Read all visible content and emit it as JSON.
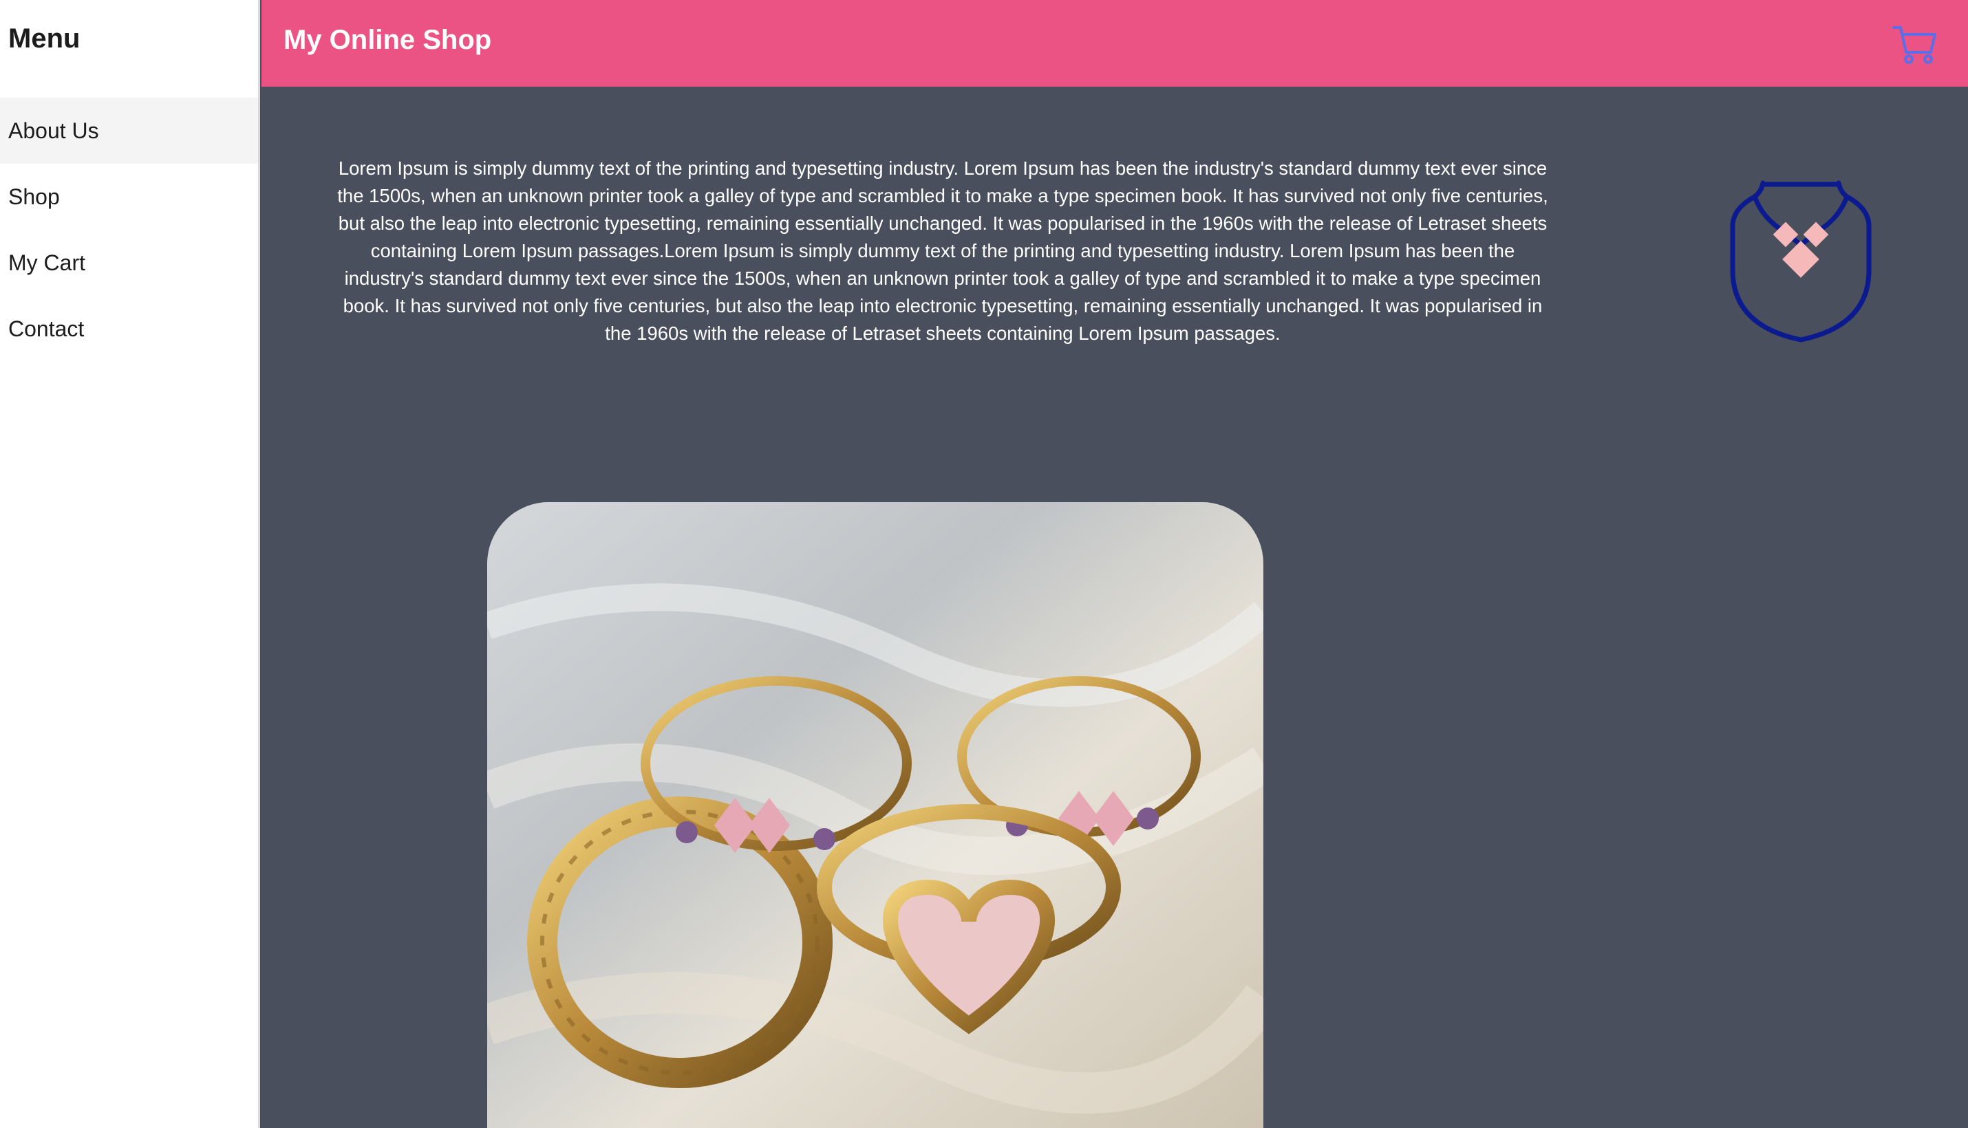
{
  "sidebar": {
    "title": "Menu",
    "items": [
      {
        "label": "About Us",
        "active": true
      },
      {
        "label": "Shop",
        "active": false
      },
      {
        "label": "My Cart",
        "active": false
      },
      {
        "label": "Contact",
        "active": false
      }
    ]
  },
  "header": {
    "title": "My Online Shop",
    "cart_icon": "cart-icon",
    "background_color": "#ea5384"
  },
  "main": {
    "background_color": "#4a4f5d",
    "intro_text": "Lorem Ipsum is simply dummy text of the printing and typesetting industry. Lorem Ipsum has been the industry's standard dummy text ever since the 1500s, when an unknown printer took a galley of type and scrambled it to make a type specimen book. It has survived not only five centuries, but also the leap into electronic typesetting, remaining essentially unchanged. It was popularised in the 1960s with the release of Letraset sheets containing Lorem Ipsum passages.Lorem Ipsum is simply dummy text of the printing and typesetting industry. Lorem Ipsum has been the industry's standard dummy text ever since the 1500s, when an unknown printer took a galley of type and scrambled it to make a type specimen book. It has survived not only five centuries, but also the leap into electronic typesetting, remaining essentially unchanged. It was popularised in the 1960s with the release of Letraset sheets containing Lorem Ipsum passages.",
    "logo_icon": "necklace-logo-icon",
    "product_image": "gold-rings-photo"
  }
}
